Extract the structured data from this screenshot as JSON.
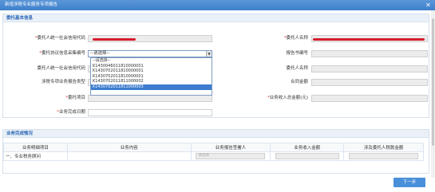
{
  "window": {
    "title": "新增涉税专业服务专项报告"
  },
  "section1": {
    "title": "委托基本信息",
    "fields": {
      "credit_code_label": "委托人统一社会信用代码",
      "client_name_label": "委托人名称",
      "agreement_no_label": "委托协议信息采集编号",
      "agreement_select_value": "--请选择--",
      "report_no_label": "报告书编号",
      "client_credit_label2": "委托人统一社会信用代码",
      "client_name_label2": "委托人名称",
      "tax_special_label": "涉税专项业务报告类型",
      "contract_amount_label": "合同金额",
      "project_label": "委托项目",
      "income_label": "业务收入总金额(元)",
      "finish_date_label": "业务完成日期"
    },
    "dropdown_options": [
      "--请选择--",
      "K1430046011810000001",
      "K1430702011810000001",
      "K1430702011810000001",
      "K1430702011811000002",
      "K1430702011811000003"
    ]
  },
  "section2": {
    "title": "业务完成情况",
    "columns": [
      "业务明细项目",
      "业务内容",
      "业务报告签署人",
      "业务收入金额",
      "涉及委托人税款金额"
    ],
    "rows": [
      {
        "item": "一、专业税务顾问",
        "signer_placeholder": "请选择"
      }
    ]
  },
  "footer": {
    "next_label": "下一步"
  },
  "colors": {
    "accent": "#4a8fd9",
    "title_bar": "#3f80cc",
    "required": "#e03a3a",
    "redaction": "#d71b2c"
  }
}
